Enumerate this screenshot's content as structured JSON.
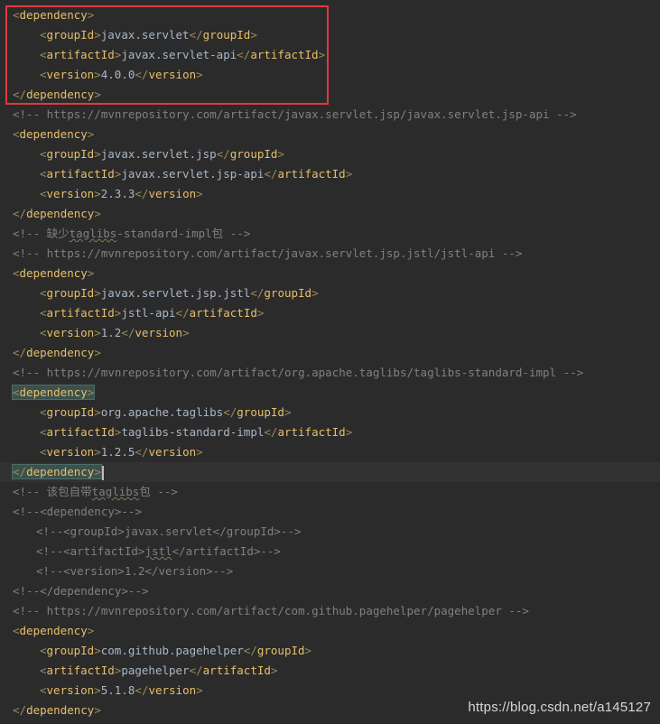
{
  "editor": {
    "lines": [
      {
        "kind": "open",
        "indent": 0,
        "tag": "dependency"
      },
      {
        "kind": "elem",
        "indent": 1,
        "tag": "groupId",
        "value": "javax.servlet"
      },
      {
        "kind": "elem",
        "indent": 1,
        "tag": "artifactId",
        "value": "javax.servlet-api"
      },
      {
        "kind": "elem",
        "indent": 1,
        "tag": "version",
        "value": "4.0.0"
      },
      {
        "kind": "close",
        "indent": 0,
        "tag": "dependency"
      },
      {
        "kind": "comment",
        "indent": 0,
        "text": "<!-- https://mvnrepository.com/artifact/javax.servlet.jsp/javax.servlet.jsp-api -->"
      },
      {
        "kind": "open",
        "indent": 0,
        "tag": "dependency"
      },
      {
        "kind": "elem",
        "indent": 1,
        "tag": "groupId",
        "value": "javax.servlet.jsp"
      },
      {
        "kind": "elem",
        "indent": 1,
        "tag": "artifactId",
        "value": "javax.servlet.jsp-api"
      },
      {
        "kind": "elem",
        "indent": 1,
        "tag": "version",
        "value": "2.3.3"
      },
      {
        "kind": "close",
        "indent": 0,
        "tag": "dependency"
      },
      {
        "kind": "comment_sq",
        "indent": 0,
        "before": "<!-- 缺少",
        "sq": "taglibs",
        "after": "-standard-impl包 -->"
      },
      {
        "kind": "comment",
        "indent": 0,
        "text": "<!-- https://mvnrepository.com/artifact/javax.servlet.jsp.jstl/jstl-api -->"
      },
      {
        "kind": "open",
        "indent": 0,
        "tag": "dependency"
      },
      {
        "kind": "elem",
        "indent": 1,
        "tag": "groupId",
        "value": "javax.servlet.jsp.jstl"
      },
      {
        "kind": "elem",
        "indent": 1,
        "tag": "artifactId",
        "value": "jstl-api"
      },
      {
        "kind": "elem",
        "indent": 1,
        "tag": "version",
        "value": "1.2"
      },
      {
        "kind": "close",
        "indent": 0,
        "tag": "dependency"
      },
      {
        "kind": "comment",
        "indent": 0,
        "text": "<!-- https://mvnrepository.com/artifact/org.apache.taglibs/taglibs-standard-impl -->"
      },
      {
        "kind": "open",
        "indent": 0,
        "tag": "dependency",
        "match": true
      },
      {
        "kind": "elem",
        "indent": 1,
        "tag": "groupId",
        "value": "org.apache.taglibs"
      },
      {
        "kind": "elem",
        "indent": 1,
        "tag": "artifactId",
        "value": "taglibs-standard-impl"
      },
      {
        "kind": "elem",
        "indent": 1,
        "tag": "version",
        "value": "1.2.5"
      },
      {
        "kind": "close",
        "indent": 0,
        "tag": "dependency",
        "match": true,
        "caret": true
      },
      {
        "kind": "comment_sq",
        "indent": 0,
        "before": "<!-- 该包自带",
        "sq": "taglibs",
        "after": "包 -->"
      },
      {
        "kind": "comment",
        "indent": 0,
        "text": "<!--<dependency>-->"
      },
      {
        "kind": "comment",
        "indent": 1,
        "text": "<!--<groupId>javax.servlet</groupId>-->"
      },
      {
        "kind": "comment_sq",
        "indent": 1,
        "before": "<!--<artifactId>",
        "sq": "jstl",
        "after": "</artifactId>-->"
      },
      {
        "kind": "comment",
        "indent": 1,
        "text": "<!--<version>1.2</version>-->"
      },
      {
        "kind": "comment",
        "indent": 0,
        "text": "<!--</dependency>-->"
      },
      {
        "kind": "comment",
        "indent": 0,
        "text": "<!-- https://mvnrepository.com/artifact/com.github.pagehelper/pagehelper -->"
      },
      {
        "kind": "open",
        "indent": 0,
        "tag": "dependency"
      },
      {
        "kind": "elem",
        "indent": 1,
        "tag": "groupId",
        "value": "com.github.pagehelper"
      },
      {
        "kind": "elem",
        "indent": 1,
        "tag": "artifactId",
        "value": "pagehelper"
      },
      {
        "kind": "elem",
        "indent": 1,
        "tag": "version",
        "value": "5.1.8"
      },
      {
        "kind": "close",
        "indent": 0,
        "tag": "dependency"
      }
    ]
  },
  "annotation": {
    "box_color": "#e0393e"
  },
  "watermark": {
    "text": "https://blog.csdn.net/a145127"
  },
  "colors": {
    "background": "#2b2b2b",
    "tag": "#e8bf6a",
    "text": "#a9b7c6",
    "comment": "#808080",
    "match_bg": "#3b514d"
  }
}
